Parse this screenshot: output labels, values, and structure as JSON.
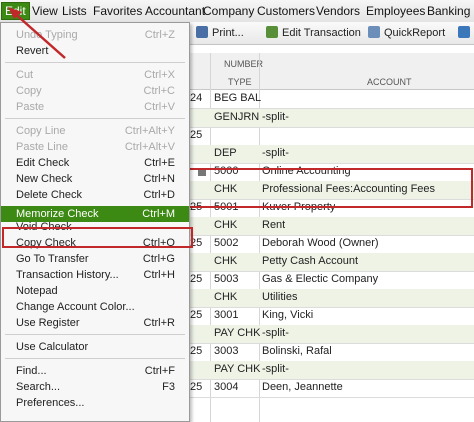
{
  "menubar": {
    "items": [
      "Edit",
      "View",
      "Lists",
      "Favorites",
      "Accountant",
      "Company",
      "Customers",
      "Vendors",
      "Employees",
      "Banking"
    ]
  },
  "toolbar": {
    "print": "Print...",
    "edit_transaction": "Edit Transaction",
    "quickreport": "QuickReport"
  },
  "register": {
    "headers": {
      "number": "NUMBER",
      "type": "TYPE",
      "account": "ACCOUNT"
    },
    "rows": [
      {
        "date": "24",
        "num": "",
        "type": "BEG BAL",
        "acct": ""
      },
      {
        "date": "",
        "num": "",
        "type": "GENJRN",
        "acct": "-split-"
      },
      {
        "date": "25",
        "num": "",
        "type": "",
        "acct": ""
      },
      {
        "date": "",
        "num": "",
        "type": "DEP",
        "acct": "-split-"
      },
      {
        "date": "",
        "num": "5000",
        "type": "",
        "acct": "Online Accounting"
      },
      {
        "date": "",
        "num": "",
        "type": "CHK",
        "acct": "Professional Fees:Accounting Fees"
      },
      {
        "date": "25",
        "num": "5001",
        "type": "",
        "acct": "Kuver Property"
      },
      {
        "date": "",
        "num": "",
        "type": "CHK",
        "acct": "Rent"
      },
      {
        "date": "25",
        "num": "5002",
        "type": "",
        "acct": "Deborah Wood (Owner)"
      },
      {
        "date": "",
        "num": "",
        "type": "CHK",
        "acct": "Petty Cash Account"
      },
      {
        "date": "25",
        "num": "5003",
        "type": "",
        "acct": "Gas & Electic Company"
      },
      {
        "date": "",
        "num": "",
        "type": "CHK",
        "acct": "Utilities"
      },
      {
        "date": "25",
        "num": "3001",
        "type": "",
        "acct": "King, Vicki"
      },
      {
        "date": "",
        "num": "",
        "type": "PAY CHK",
        "acct": "-split-"
      },
      {
        "date": "25",
        "num": "3003",
        "type": "",
        "acct": "Bolinski, Rafal"
      },
      {
        "date": "",
        "num": "",
        "type": "PAY CHK",
        "acct": "-split-"
      },
      {
        "date": "25",
        "num": "3004",
        "type": "",
        "acct": "Deen, Jeannette"
      }
    ]
  },
  "edit_menu": [
    {
      "label": "Undo Typing",
      "shortcut": "Ctrl+Z",
      "disabled": true
    },
    {
      "label": "Revert",
      "shortcut": "",
      "disabled": false
    },
    {
      "label": "Cut",
      "shortcut": "Ctrl+X",
      "disabled": true
    },
    {
      "label": "Copy",
      "shortcut": "Ctrl+C",
      "disabled": true
    },
    {
      "label": "Paste",
      "shortcut": "Ctrl+V",
      "disabled": true
    },
    {
      "label": "Copy Line",
      "shortcut": "Ctrl+Alt+Y",
      "disabled": true
    },
    {
      "label": "Paste Line",
      "shortcut": "Ctrl+Alt+V",
      "disabled": true
    },
    {
      "label": "Edit Check",
      "shortcut": "Ctrl+E",
      "disabled": false
    },
    {
      "label": "New Check",
      "shortcut": "Ctrl+N",
      "disabled": false
    },
    {
      "label": "Delete Check",
      "shortcut": "Ctrl+D",
      "disabled": false
    },
    {
      "label": "Memorize Check",
      "shortcut": "Ctrl+M",
      "disabled": false,
      "selected": true
    },
    {
      "label": "Void Check",
      "shortcut": "",
      "disabled": false
    },
    {
      "label": "Copy Check",
      "shortcut": "Ctrl+O",
      "disabled": false
    },
    {
      "label": "Go To Transfer",
      "shortcut": "Ctrl+G",
      "disabled": false
    },
    {
      "label": "Transaction History...",
      "shortcut": "Ctrl+H",
      "disabled": false
    },
    {
      "label": "Notepad",
      "shortcut": "",
      "disabled": false
    },
    {
      "label": "Change Account Color...",
      "shortcut": "",
      "disabled": false
    },
    {
      "label": "Use Register",
      "shortcut": "Ctrl+R",
      "disabled": false
    },
    {
      "label": "Use Calculator",
      "shortcut": "",
      "disabled": false
    },
    {
      "label": "Find...",
      "shortcut": "Ctrl+F",
      "disabled": false
    },
    {
      "label": "Search...",
      "shortcut": "F3",
      "disabled": false
    },
    {
      "label": "Preferences...",
      "shortcut": "",
      "disabled": false
    }
  ],
  "colors": {
    "accent": "#3c8a14",
    "highlight": "#c0282a"
  }
}
